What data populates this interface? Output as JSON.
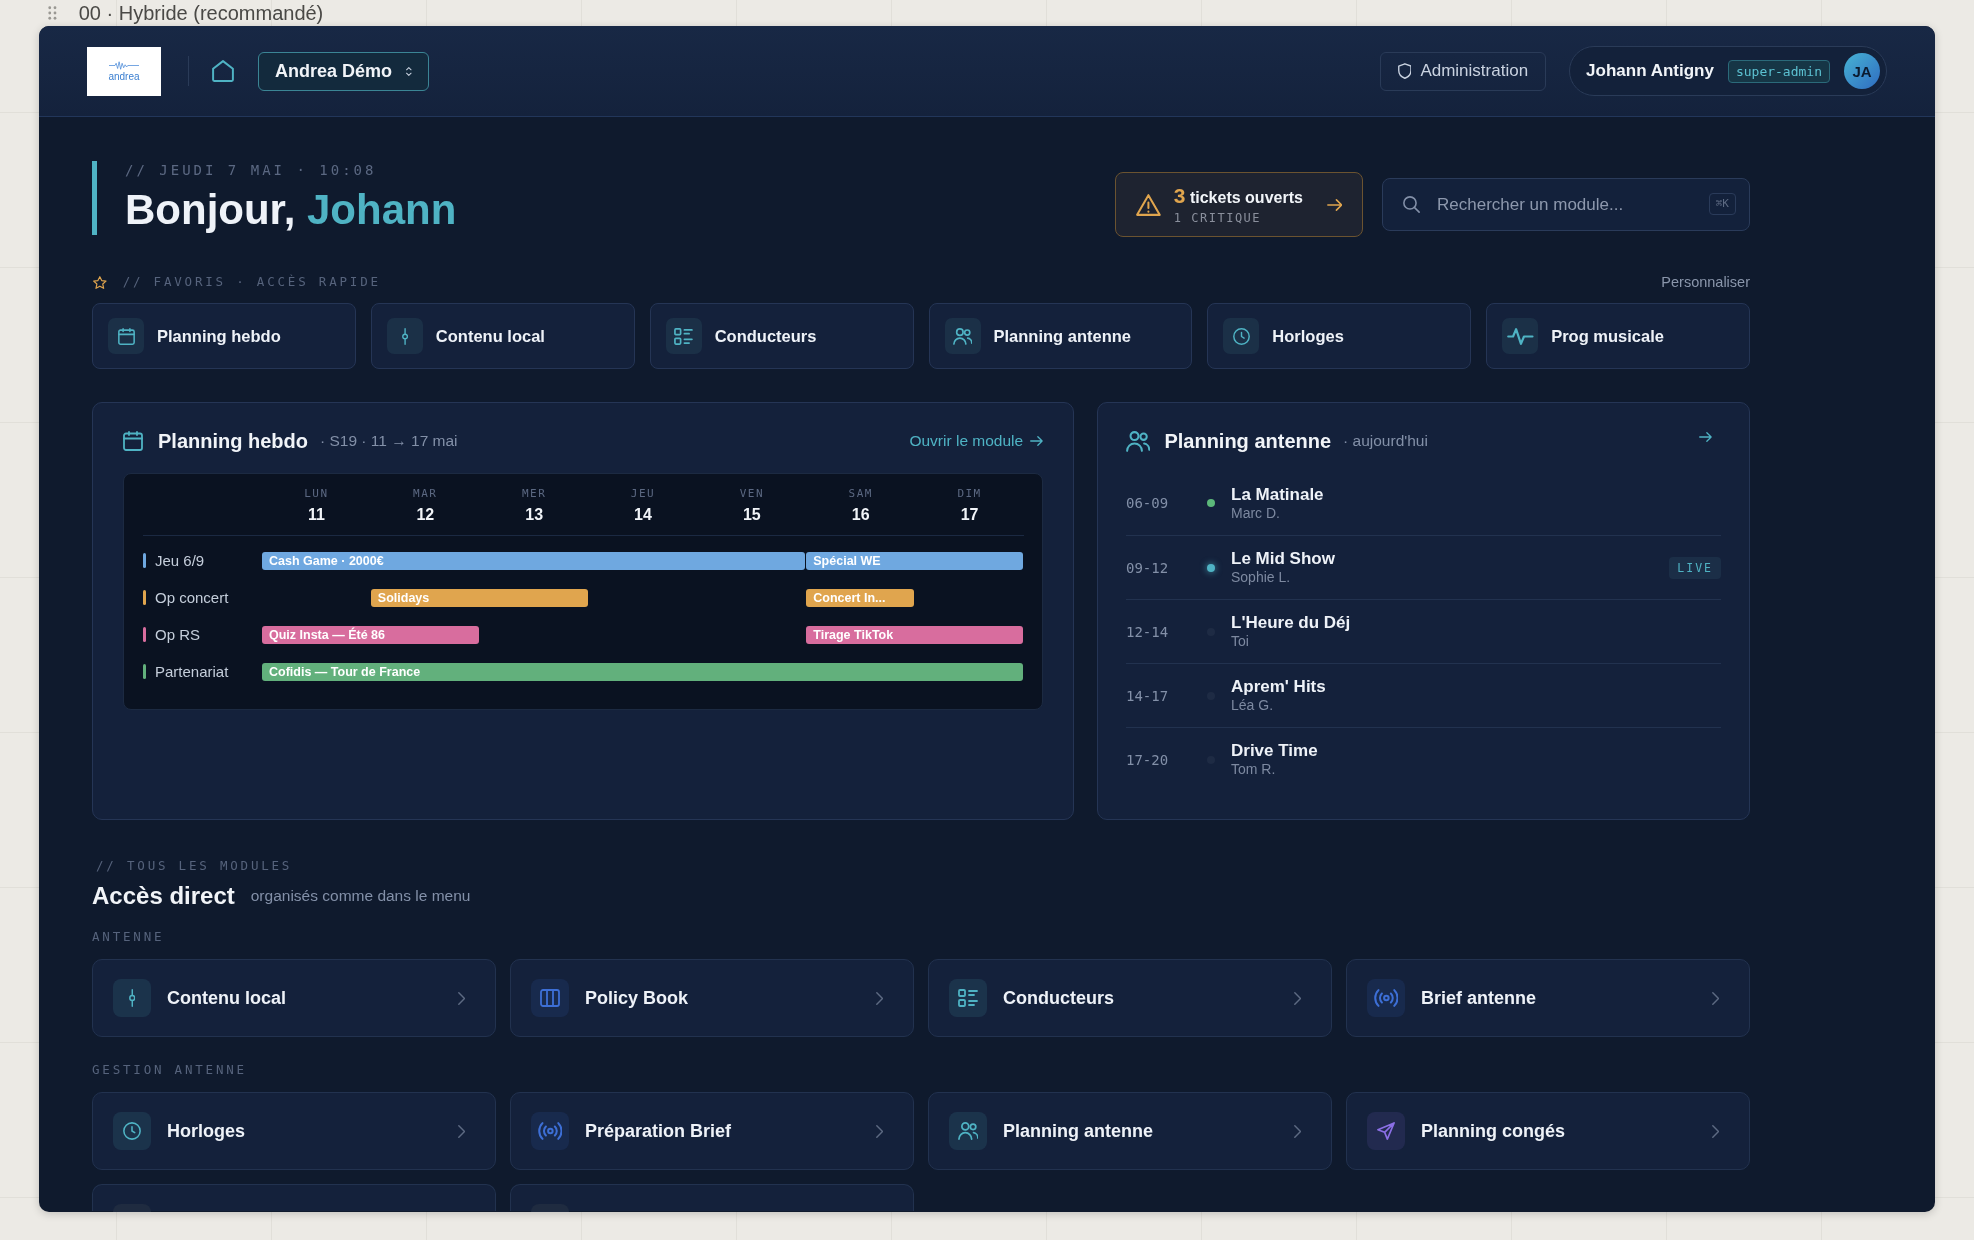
{
  "page_title": "00 · Hybride (recommandé)",
  "header": {
    "logo": "andrea",
    "workspace": "Andrea Démo",
    "admin": "Administration",
    "user": {
      "name": "Johann Antigny",
      "role": "super-admin",
      "initials": "JA"
    }
  },
  "greeting": {
    "date": "// JEUDI 7 MAI · 10:08",
    "hello": "Bonjour,",
    "name": "Johann"
  },
  "tickets": {
    "count": "3",
    "label": "tickets ouverts",
    "detail": "1 CRITIQUE"
  },
  "search": {
    "placeholder": "Rechercher un module...",
    "shortcut": "⌘K"
  },
  "favorites": {
    "title": "// FAVORIS · ACCÈS RAPIDE",
    "action": "Personnaliser",
    "items": [
      {
        "label": "Planning hebdo",
        "kind": "calendar"
      },
      {
        "label": "Contenu local",
        "kind": "pin"
      },
      {
        "label": "Conducteurs",
        "kind": "list"
      },
      {
        "label": "Planning antenne",
        "kind": "people"
      },
      {
        "label": "Horloges",
        "kind": "clock"
      },
      {
        "label": "Prog musicale",
        "kind": "pulse"
      }
    ]
  },
  "planning_hebdo": {
    "title": "Planning hebdo",
    "subtitle": "· S19 · 11 → 17 mai",
    "link": "Ouvrir le module",
    "days": [
      {
        "name": "LUN",
        "date": "11"
      },
      {
        "name": "MAR",
        "date": "12"
      },
      {
        "name": "MER",
        "date": "13"
      },
      {
        "name": "JEU",
        "date": "14"
      },
      {
        "name": "VEN",
        "date": "15"
      },
      {
        "name": "SAM",
        "date": "16"
      },
      {
        "name": "DIM",
        "date": "17"
      }
    ],
    "rows": [
      {
        "label": "Jeu 6/9",
        "color": "#6fa8e0",
        "events": [
          {
            "title": "Cash Game · 2000€",
            "kind": "mon-fri"
          },
          {
            "title": "Spécial WE",
            "kind": "sat-sun"
          }
        ]
      },
      {
        "label": "Op concert",
        "color": "#e0a54e",
        "events": [
          {
            "title": "Solidays",
            "kind": "tue-wed"
          },
          {
            "title": "Concert In...",
            "kind": "sat"
          }
        ]
      },
      {
        "label": "Op RS",
        "color": "#d86d9e",
        "events": [
          {
            "title": "Quiz Insta — Été 86",
            "kind": "mon-tue"
          },
          {
            "title": "Tirage TikTok",
            "kind": "sat-sun"
          }
        ]
      },
      {
        "label": "Partenariat",
        "color": "#62b07c",
        "events": [
          {
            "title": "Cofidis — Tour de France",
            "kind": "mon-sun"
          }
        ]
      }
    ]
  },
  "planning_antenne": {
    "title": "Planning antenne",
    "subtitle": "· aujourd'hui",
    "shows": [
      {
        "time": "06-09",
        "title": "La Matinale",
        "host": "Marc D.",
        "color": "#5cb87a"
      },
      {
        "time": "09-12",
        "title": "Le Mid Show",
        "host": "Sophie L.",
        "color": "#4fb3c4",
        "badge": "LIVE"
      },
      {
        "time": "12-14",
        "title": "L'Heure du Déj",
        "host": "Toi",
        "color": "#1e2b44"
      },
      {
        "time": "14-17",
        "title": "Aprem' Hits",
        "host": "Léa G.",
        "color": "#1e2b44"
      },
      {
        "time": "17-20",
        "title": "Drive Time",
        "host": "Tom R.",
        "color": "#1e2b44"
      }
    ]
  },
  "modules": {
    "eyebrow": "// TOUS LES MODULES",
    "title": "Accès direct",
    "subtitle": "organisés comme dans le menu",
    "groups": [
      {
        "name": "ANTENNE",
        "items": [
          {
            "label": "Contenu local",
            "kind": "pin",
            "color": "#4fb3c4"
          },
          {
            "label": "Policy Book",
            "kind": "columns",
            "color": "#3d6fd6"
          },
          {
            "label": "Conducteurs",
            "kind": "list",
            "color": "#4fb3c4"
          },
          {
            "label": "Brief antenne",
            "kind": "broadcast",
            "color": "#3d6fd6"
          }
        ]
      },
      {
        "name": "GESTION ANTENNE",
        "items": [
          {
            "label": "Horloges",
            "kind": "clock",
            "color": "#4fb3c4"
          },
          {
            "label": "Préparation Brief",
            "kind": "broadcast",
            "color": "#3d6fd6"
          },
          {
            "label": "Planning antenne",
            "kind": "people",
            "color": "#4fb3c4"
          },
          {
            "label": "Planning congés",
            "kind": "send",
            "color": "#8b6fe6"
          },
          {
            "kind": "cut"
          },
          {
            "kind": "cut"
          }
        ]
      }
    ]
  }
}
